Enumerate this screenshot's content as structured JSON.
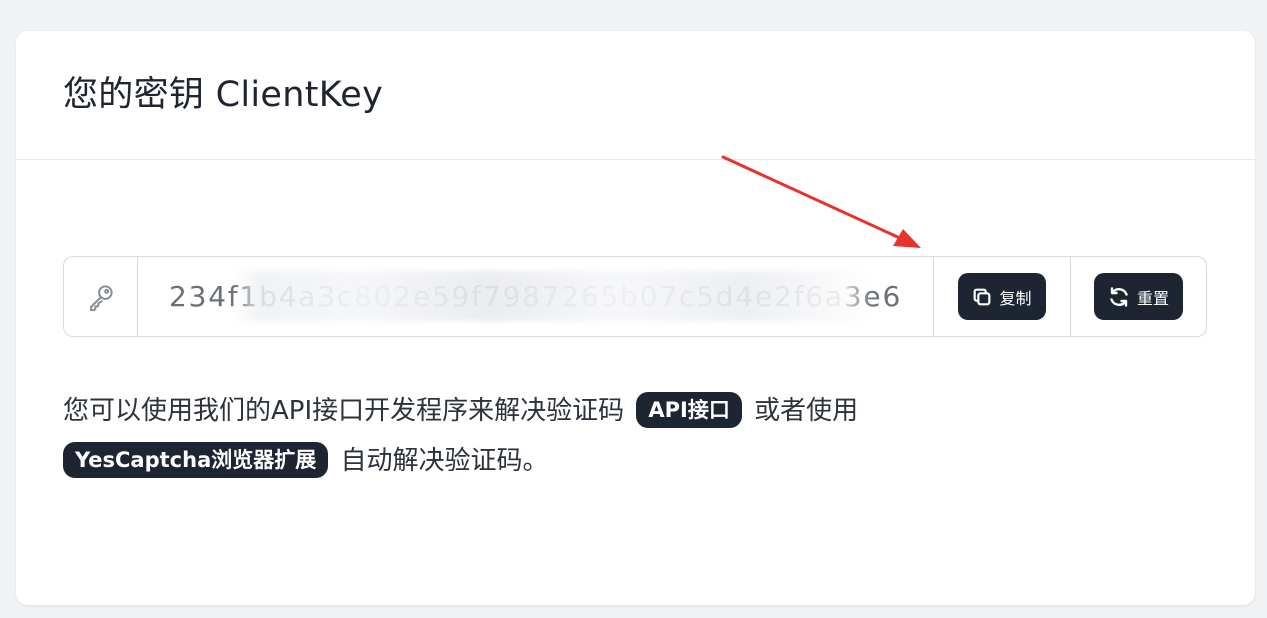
{
  "card": {
    "title": "您的密钥 ClientKey"
  },
  "key": {
    "value": "234f1b4a3c802e59f7987265b07c5d4e2f6a3e6",
    "icon": "key-icon"
  },
  "buttons": {
    "copy_label": "复制",
    "copy_icon": "copy-icon",
    "reset_label": "重置",
    "reset_icon": "refresh-icon"
  },
  "description": {
    "part1": "您可以使用我们的API接口开发程序来解决验证码",
    "api_link": "API接口",
    "part2": "或者使用",
    "extension_link": "YesCaptcha浏览器扩展",
    "part3": "自动解决验证码。"
  },
  "colors": {
    "background": "#f1f2f4",
    "card": "#ffffff",
    "dark_button": "#1c2531",
    "arrow": "#e8322b",
    "border": "#d7dadf"
  }
}
